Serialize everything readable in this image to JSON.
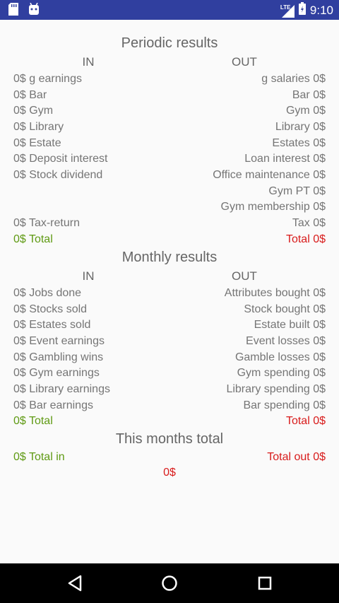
{
  "status_bar": {
    "time": "9:10",
    "network": "LTE",
    "left_icons": [
      "sd-card-icon",
      "android-icon"
    ],
    "right_icons": [
      "signal-icon",
      "battery-icon"
    ]
  },
  "periodic": {
    "title": "Periodic results",
    "in_label": "IN",
    "out_label": "OUT",
    "in_rows": [
      "0$ g earnings",
      "0$ Bar",
      "0$ Gym",
      "0$ Library",
      "0$ Estate",
      "0$ Deposit interest",
      "0$ Stock dividend"
    ],
    "out_rows": [
      "g salaries 0$",
      "Bar 0$",
      "Gym 0$",
      "Library 0$",
      "Estates 0$",
      "Loan interest 0$",
      "Office maintenance 0$",
      "Gym PT 0$",
      "Gym membership 0$"
    ],
    "tax_return": "0$ Tax-return",
    "tax": "Tax 0$",
    "total_in": "0$ Total",
    "total_out": "Total 0$"
  },
  "monthly": {
    "title": "Monthly results",
    "in_label": "IN",
    "out_label": "OUT",
    "in_rows": [
      "0$ Jobs done",
      "0$ Stocks sold",
      "0$ Estates sold",
      "0$ Event earnings",
      "0$ Gambling wins",
      "0$ Gym earnings",
      "0$ Library earnings",
      "0$ Bar earnings"
    ],
    "out_rows": [
      "Attributes bought 0$",
      "Stock bought 0$",
      "Estate built 0$",
      "Event losses 0$",
      "Gamble losses 0$",
      "Gym spending 0$",
      "Library spending 0$",
      "Bar spending 0$"
    ],
    "total_in": "0$ Total",
    "total_out": "Total 0$"
  },
  "month_total": {
    "title": "This months total",
    "total_in": "0$ Total in",
    "total_out": "Total out 0$",
    "net": "0$"
  },
  "colors": {
    "status_bar": "#303f9f",
    "positive": "#5f9a13",
    "negative": "#d81b1b",
    "text": "#757575"
  },
  "nav_bar": {
    "buttons": [
      "back-icon",
      "home-icon",
      "recents-icon"
    ]
  }
}
